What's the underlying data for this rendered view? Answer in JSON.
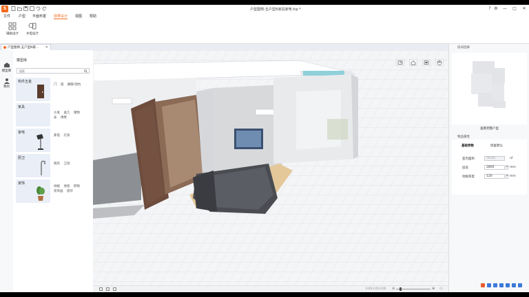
{
  "window": {
    "title": "户型图例-五户型N家具家电.fsp *",
    "controls": {
      "help": "?",
      "minimize": "—",
      "maximize": "□",
      "close": "✕"
    }
  },
  "menu": [
    {
      "label": "文件"
    },
    {
      "label": "户型"
    },
    {
      "label": "平面布置"
    },
    {
      "label": "效果设计",
      "active": true
    },
    {
      "label": "视图"
    },
    {
      "label": "帮助"
    }
  ],
  "ribbon": {
    "buttons": [
      {
        "label": "辅助设计",
        "icon": "assist-design-icon"
      },
      {
        "label": "水电设计",
        "icon": "plumbing-electric-icon"
      }
    ]
  },
  "doc_tab": {
    "label": "户型图例-五户型N家..."
  },
  "rail": [
    {
      "label": "模型库",
      "icon": "model-library-icon"
    },
    {
      "label": "我的",
      "icon": "my-items-icon"
    }
  ],
  "library": {
    "title": "模型库",
    "search_placeholder": "搜索",
    "categories": [
      {
        "name": "构件五金",
        "links": [
          [
            "门",
            "窗",
            "踢脚·围坑"
          ]
        ]
      },
      {
        "name": "家具",
        "links": [
          [
            "沙发",
            "桌几",
            "储物"
          ],
          [
            "床",
            "椅凳"
          ]
        ]
      },
      {
        "name": "家电",
        "links": [
          [
            "家电",
            "灯具"
          ]
        ]
      },
      {
        "name": "厨卫",
        "links": [
          [
            "厨房",
            "卫浴"
          ]
        ]
      },
      {
        "name": "家饰",
        "links": [
          [
            "绿植",
            "地毯",
            "织物"
          ],
          [
            "装饰画",
            "窗帘"
          ]
        ]
      }
    ]
  },
  "right_panel": {
    "header": "房间选择",
    "plan_button": "查看完整户型",
    "props_title": "物品属性",
    "tabs": [
      "基础参数",
      "恢复默认"
    ],
    "fields": [
      {
        "label": "室内面积",
        "value": "76.65",
        "unit": "㎡",
        "disabled": true
      },
      {
        "label": "层高",
        "value": "2800",
        "unit": "mm",
        "disabled": false
      },
      {
        "label": "地板厚度",
        "value": "120",
        "unit": "mm",
        "disabled": false
      }
    ]
  },
  "status": {
    "zoom_label": "0.00,2.65,0.00"
  },
  "colors": {
    "accent": "#f26b1d",
    "panel_bg": "#f3f4f6"
  }
}
